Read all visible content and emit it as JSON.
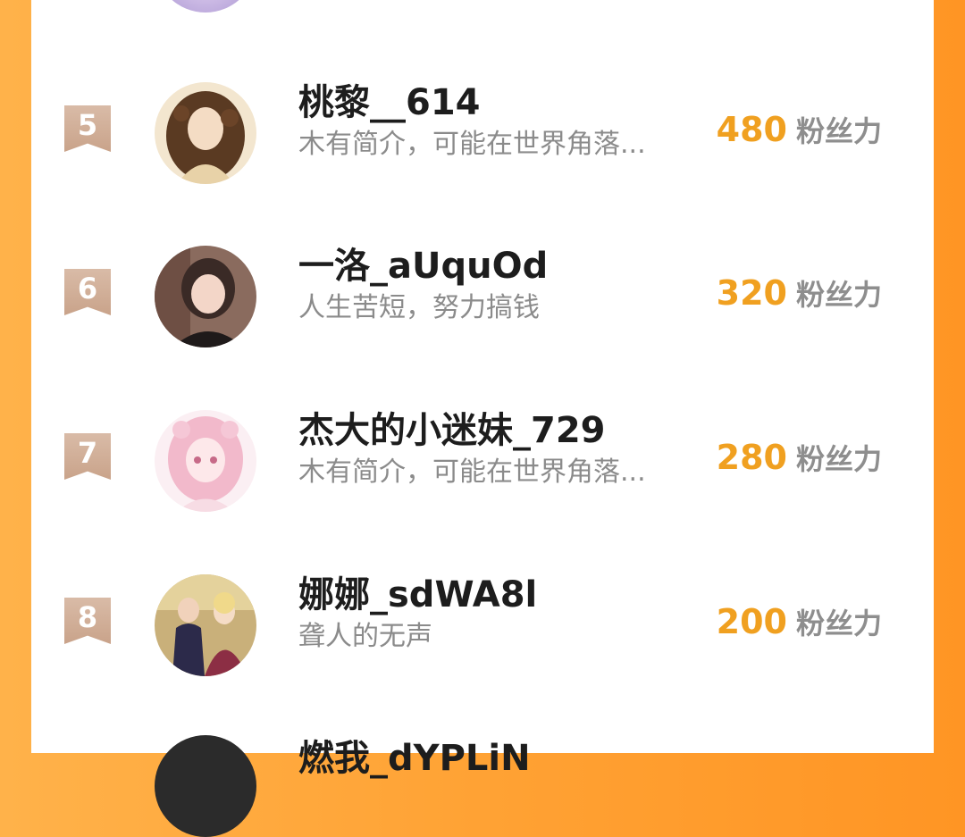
{
  "leaderboard": {
    "rows": [
      {
        "rank": "5",
        "name": "桃黎__614",
        "bio": "木有简介，可能在世界角落...",
        "score": "480",
        "unit": "粉丝力"
      },
      {
        "rank": "6",
        "name": "一洛_aUquOd",
        "bio": "人生苦短，努力搞钱",
        "score": "320",
        "unit": "粉丝力"
      },
      {
        "rank": "7",
        "name": "杰大的小迷妹_729",
        "bio": "木有简介，可能在世界角落...",
        "score": "280",
        "unit": "粉丝力"
      },
      {
        "rank": "8",
        "name": "娜娜_sdWA8l",
        "bio": "聋人的无声",
        "score": "200",
        "unit": "粉丝力"
      }
    ],
    "partial_next_name": "燃我_dYPLiN"
  },
  "colors": {
    "background": "#ffa234",
    "score": "#f0a020",
    "rank_ribbon": "#c9a38a",
    "name": "#1d1d1d",
    "bio": "#8b8b8b"
  }
}
